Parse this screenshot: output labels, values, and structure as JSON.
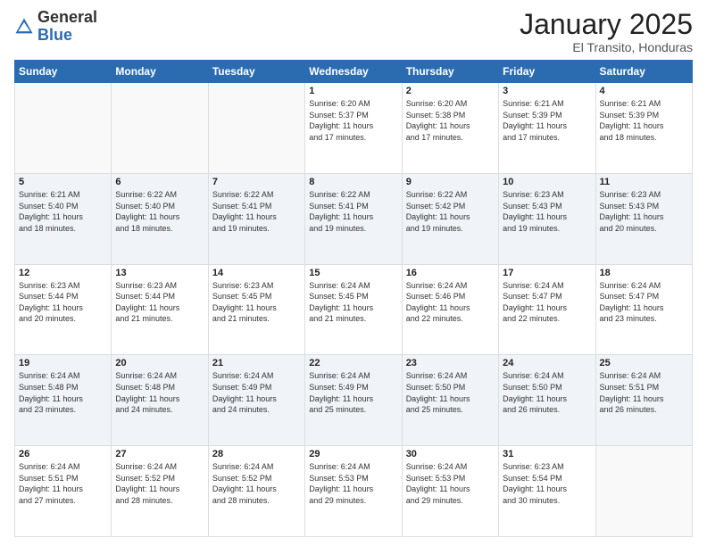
{
  "header": {
    "logo_general": "General",
    "logo_blue": "Blue",
    "title": "January 2025",
    "location": "El Transito, Honduras"
  },
  "days_of_week": [
    "Sunday",
    "Monday",
    "Tuesday",
    "Wednesday",
    "Thursday",
    "Friday",
    "Saturday"
  ],
  "weeks": [
    {
      "alt": false,
      "days": [
        {
          "num": "",
          "info": ""
        },
        {
          "num": "",
          "info": ""
        },
        {
          "num": "",
          "info": ""
        },
        {
          "num": "1",
          "info": "Sunrise: 6:20 AM\nSunset: 5:37 PM\nDaylight: 11 hours\nand 17 minutes."
        },
        {
          "num": "2",
          "info": "Sunrise: 6:20 AM\nSunset: 5:38 PM\nDaylight: 11 hours\nand 17 minutes."
        },
        {
          "num": "3",
          "info": "Sunrise: 6:21 AM\nSunset: 5:39 PM\nDaylight: 11 hours\nand 17 minutes."
        },
        {
          "num": "4",
          "info": "Sunrise: 6:21 AM\nSunset: 5:39 PM\nDaylight: 11 hours\nand 18 minutes."
        }
      ]
    },
    {
      "alt": true,
      "days": [
        {
          "num": "5",
          "info": "Sunrise: 6:21 AM\nSunset: 5:40 PM\nDaylight: 11 hours\nand 18 minutes."
        },
        {
          "num": "6",
          "info": "Sunrise: 6:22 AM\nSunset: 5:40 PM\nDaylight: 11 hours\nand 18 minutes."
        },
        {
          "num": "7",
          "info": "Sunrise: 6:22 AM\nSunset: 5:41 PM\nDaylight: 11 hours\nand 19 minutes."
        },
        {
          "num": "8",
          "info": "Sunrise: 6:22 AM\nSunset: 5:41 PM\nDaylight: 11 hours\nand 19 minutes."
        },
        {
          "num": "9",
          "info": "Sunrise: 6:22 AM\nSunset: 5:42 PM\nDaylight: 11 hours\nand 19 minutes."
        },
        {
          "num": "10",
          "info": "Sunrise: 6:23 AM\nSunset: 5:43 PM\nDaylight: 11 hours\nand 19 minutes."
        },
        {
          "num": "11",
          "info": "Sunrise: 6:23 AM\nSunset: 5:43 PM\nDaylight: 11 hours\nand 20 minutes."
        }
      ]
    },
    {
      "alt": false,
      "days": [
        {
          "num": "12",
          "info": "Sunrise: 6:23 AM\nSunset: 5:44 PM\nDaylight: 11 hours\nand 20 minutes."
        },
        {
          "num": "13",
          "info": "Sunrise: 6:23 AM\nSunset: 5:44 PM\nDaylight: 11 hours\nand 21 minutes."
        },
        {
          "num": "14",
          "info": "Sunrise: 6:23 AM\nSunset: 5:45 PM\nDaylight: 11 hours\nand 21 minutes."
        },
        {
          "num": "15",
          "info": "Sunrise: 6:24 AM\nSunset: 5:45 PM\nDaylight: 11 hours\nand 21 minutes."
        },
        {
          "num": "16",
          "info": "Sunrise: 6:24 AM\nSunset: 5:46 PM\nDaylight: 11 hours\nand 22 minutes."
        },
        {
          "num": "17",
          "info": "Sunrise: 6:24 AM\nSunset: 5:47 PM\nDaylight: 11 hours\nand 22 minutes."
        },
        {
          "num": "18",
          "info": "Sunrise: 6:24 AM\nSunset: 5:47 PM\nDaylight: 11 hours\nand 23 minutes."
        }
      ]
    },
    {
      "alt": true,
      "days": [
        {
          "num": "19",
          "info": "Sunrise: 6:24 AM\nSunset: 5:48 PM\nDaylight: 11 hours\nand 23 minutes."
        },
        {
          "num": "20",
          "info": "Sunrise: 6:24 AM\nSunset: 5:48 PM\nDaylight: 11 hours\nand 24 minutes."
        },
        {
          "num": "21",
          "info": "Sunrise: 6:24 AM\nSunset: 5:49 PM\nDaylight: 11 hours\nand 24 minutes."
        },
        {
          "num": "22",
          "info": "Sunrise: 6:24 AM\nSunset: 5:49 PM\nDaylight: 11 hours\nand 25 minutes."
        },
        {
          "num": "23",
          "info": "Sunrise: 6:24 AM\nSunset: 5:50 PM\nDaylight: 11 hours\nand 25 minutes."
        },
        {
          "num": "24",
          "info": "Sunrise: 6:24 AM\nSunset: 5:50 PM\nDaylight: 11 hours\nand 26 minutes."
        },
        {
          "num": "25",
          "info": "Sunrise: 6:24 AM\nSunset: 5:51 PM\nDaylight: 11 hours\nand 26 minutes."
        }
      ]
    },
    {
      "alt": false,
      "days": [
        {
          "num": "26",
          "info": "Sunrise: 6:24 AM\nSunset: 5:51 PM\nDaylight: 11 hours\nand 27 minutes."
        },
        {
          "num": "27",
          "info": "Sunrise: 6:24 AM\nSunset: 5:52 PM\nDaylight: 11 hours\nand 28 minutes."
        },
        {
          "num": "28",
          "info": "Sunrise: 6:24 AM\nSunset: 5:52 PM\nDaylight: 11 hours\nand 28 minutes."
        },
        {
          "num": "29",
          "info": "Sunrise: 6:24 AM\nSunset: 5:53 PM\nDaylight: 11 hours\nand 29 minutes."
        },
        {
          "num": "30",
          "info": "Sunrise: 6:24 AM\nSunset: 5:53 PM\nDaylight: 11 hours\nand 29 minutes."
        },
        {
          "num": "31",
          "info": "Sunrise: 6:23 AM\nSunset: 5:54 PM\nDaylight: 11 hours\nand 30 minutes."
        },
        {
          "num": "",
          "info": ""
        }
      ]
    }
  ]
}
